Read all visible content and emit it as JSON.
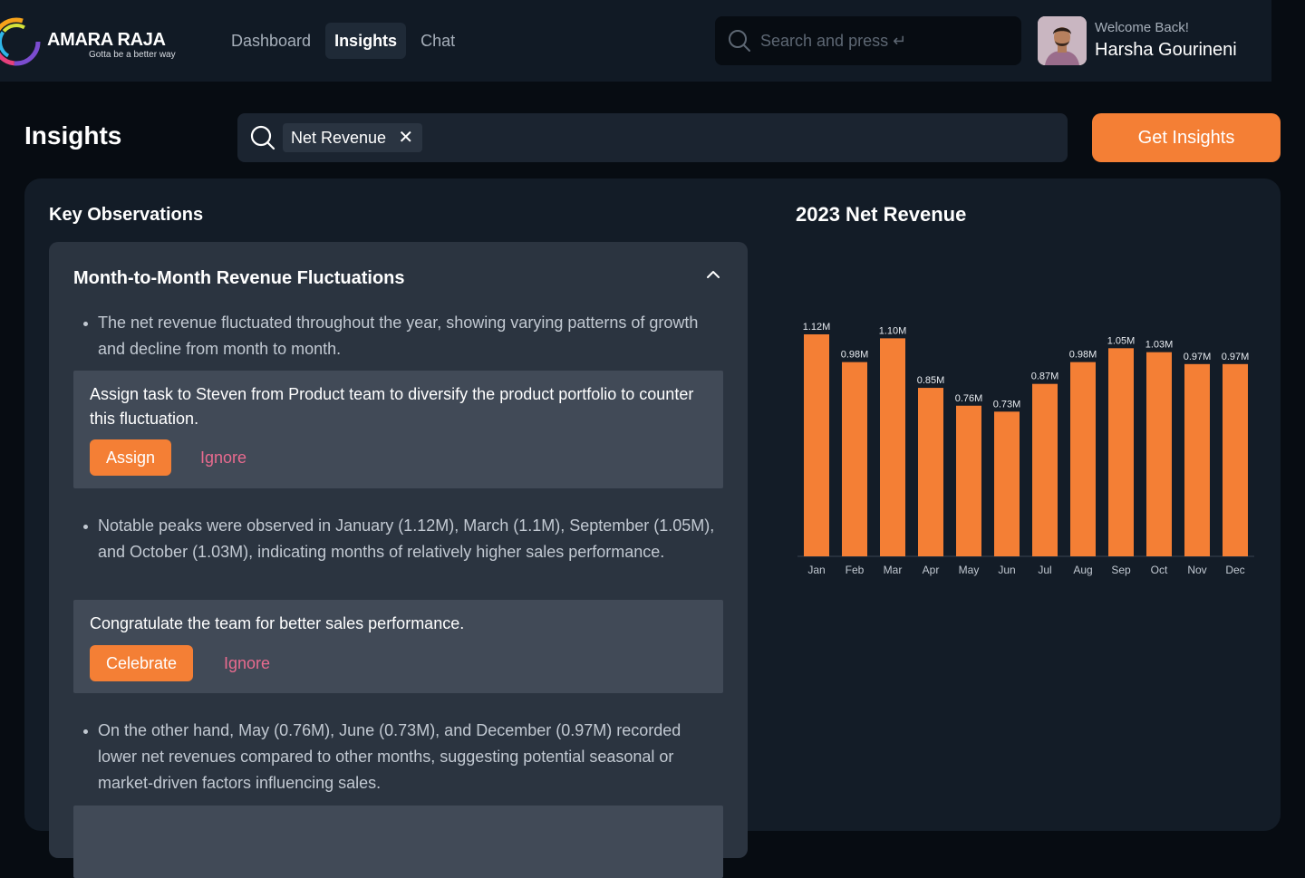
{
  "brand": {
    "name": "AMARA RAJA",
    "tagline": "Gotta be a better way"
  },
  "nav": {
    "items": [
      {
        "label": "Dashboard",
        "active": false
      },
      {
        "label": "Insights",
        "active": true
      },
      {
        "label": "Chat",
        "active": false
      }
    ]
  },
  "search": {
    "placeholder": "Search and press ↵"
  },
  "user": {
    "greeting": "Welcome Back!",
    "name": "Harsha Gourineni"
  },
  "page": {
    "title": "Insights",
    "filter_chip": "Net Revenue",
    "filter_chip_close": "✕",
    "get_insights_label": "Get Insights"
  },
  "observations": {
    "section_title": "Key Observations",
    "card_title": "Month-to-Month Revenue Fluctuations",
    "bullets": [
      {
        "text": "The net revenue fluctuated throughout the year, showing varying patterns of growth and decline from month to month.",
        "action": "Assign task to Steven from Product team to diversify the product portfolio to counter this fluctuation.",
        "primary_label": "Assign",
        "secondary_label": "Ignore"
      },
      {
        "text": "Notable peaks were observed in January (1.12M), March (1.1M), September (1.05M), and October (1.03M), indicating months of relatively higher sales performance.",
        "action": "Congratulate the team for better sales performance.",
        "primary_label": "Celebrate",
        "secondary_label": "Ignore"
      },
      {
        "text": "On the other hand, May (0.76M), June (0.73M), and December (0.97M) recorded lower net revenues compared to other months, suggesting potential seasonal or market-driven factors influencing sales."
      }
    ]
  },
  "chart_data": {
    "type": "bar",
    "title": "2023 Net Revenue",
    "categories": [
      "Jan",
      "Feb",
      "Mar",
      "Apr",
      "May",
      "Jun",
      "Jul",
      "Aug",
      "Sep",
      "Oct",
      "Nov",
      "Dec"
    ],
    "values": [
      1.12,
      0.98,
      1.1,
      0.85,
      0.76,
      0.73,
      0.87,
      0.98,
      1.05,
      1.03,
      0.97,
      0.97
    ],
    "data_labels": [
      "1.12M",
      "0.98M",
      "1.10M",
      "0.85M",
      "0.76M",
      "0.73M",
      "0.87M",
      "0.98M",
      "1.05M",
      "1.03M",
      "0.97M",
      "0.97M"
    ],
    "ylim": [
      0,
      1.12
    ],
    "grid": false,
    "legend": "none",
    "bar_color": "#f47f35"
  },
  "colors": {
    "accent": "#f47f35",
    "link": "#e96b8f",
    "background": "#070c12",
    "panel": "#131c27",
    "card": "#2b3440"
  }
}
